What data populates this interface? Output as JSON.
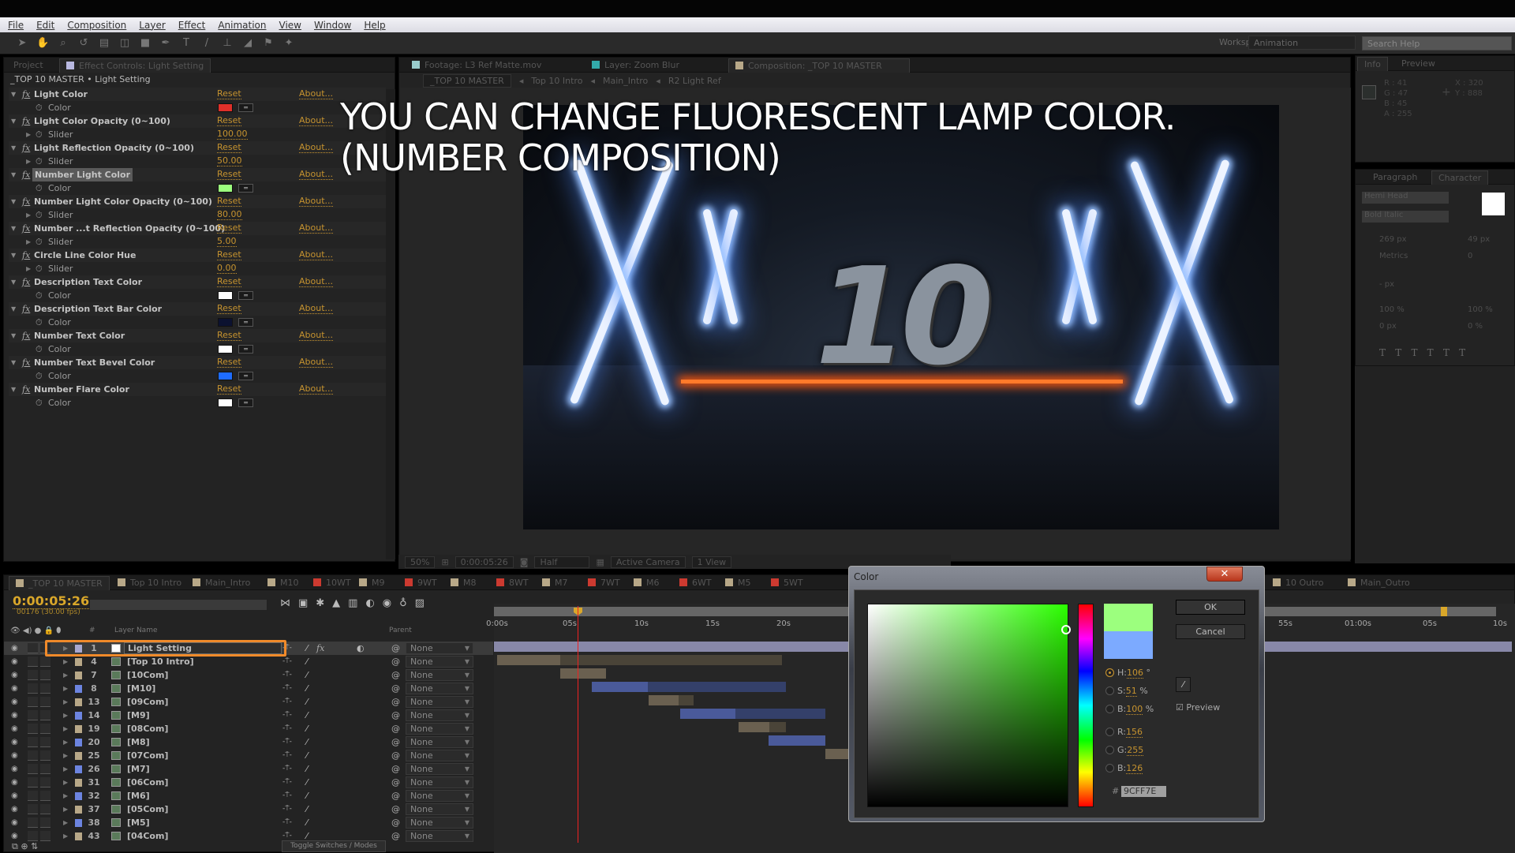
{
  "menu": [
    "File",
    "Edit",
    "Composition",
    "Layer",
    "Effect",
    "Animation",
    "View",
    "Window",
    "Help"
  ],
  "toolbar": {
    "workspace_label": "Workspace:",
    "workspace_value": "Animation",
    "search_placeholder": "Search Help"
  },
  "left_panel": {
    "tabs": [
      "Project",
      "Effect Controls: Light Setting"
    ],
    "breadcrumb": "_TOP 10 MASTER • Light Setting",
    "reset_label": "Reset",
    "about_label": "About...",
    "effects": [
      {
        "name": "Light Color",
        "param": "Color",
        "type": "color",
        "value": "#e0302a"
      },
      {
        "name": "Light Color Opacity (0~100)",
        "param": "Slider",
        "type": "slider",
        "value": "100.00"
      },
      {
        "name": "Light Reflection Opacity (0~100)",
        "param": "Slider",
        "type": "slider",
        "value": "50.00"
      },
      {
        "name": "Number Light Color",
        "param": "Color",
        "type": "color",
        "value": "#9cff7e",
        "selected": true
      },
      {
        "name": "Number Light Color Opacity (0~100)",
        "param": "Slider",
        "type": "slider",
        "value": "80.00"
      },
      {
        "name": "Number ...t Reflection Opacity (0~100)",
        "param": "Slider",
        "type": "slider",
        "value": "5.00"
      },
      {
        "name": "Circle Line Color Hue",
        "param": "Slider",
        "type": "slider",
        "value": "0.00"
      },
      {
        "name": "Description Text Color",
        "param": "Color",
        "type": "color",
        "value": "#ffffff"
      },
      {
        "name": "Description Text Bar Color",
        "param": "Color",
        "type": "color",
        "value": "#0c1230"
      },
      {
        "name": "Number Text Color",
        "param": "Color",
        "type": "color",
        "value": "#ffffff"
      },
      {
        "name": "Number Text Bevel Color",
        "param": "Color",
        "type": "color",
        "value": "#1e6cff"
      },
      {
        "name": "Number Flare Color",
        "param": "Color",
        "type": "color",
        "value": "#ffffff"
      }
    ]
  },
  "comp_panel": {
    "tabs": [
      "Footage: L3 Ref Matte.mov",
      "Layer: Zoom Blur",
      "Composition: _TOP 10 MASTER"
    ],
    "breadcrumb": [
      "_TOP 10 MASTER",
      "Top 10 Intro",
      "Main_Intro",
      "R2 Light Ref"
    ],
    "overlay_line1": "YOU CAN CHANGE FLUORESCENT LAMP COLOR.",
    "overlay_line2": "(NUMBER COMPOSITION)",
    "scene_number": "10",
    "viewer_toolbar": {
      "zoom": "50%",
      "timecode": "0:00:05:26",
      "resolution": "Half",
      "camera": "Active Camera",
      "views": "1 View"
    }
  },
  "info_panel": {
    "tabs": [
      "Info",
      "Preview"
    ],
    "r": "R : 41",
    "g": "G : 47",
    "b": "B : 45",
    "a": "A : 255",
    "x": "X : 320",
    "y": "Y : 888"
  },
  "character_panel": {
    "tabs": [
      "Paragraph",
      "Character"
    ],
    "font": "Hemi Head",
    "style": "Bold Italic",
    "size": "269 px",
    "leading": "49 px",
    "kerning": "Metrics",
    "tracking": "0",
    "stroke": "- px",
    "vscale": "100 %",
    "hscale": "100 %",
    "baseline": "0 px",
    "tsume": "0 %"
  },
  "timeline": {
    "tabs": [
      {
        "label": "_TOP 10 MASTER",
        "color": "#b8a888"
      },
      {
        "label": "Top 10 Intro",
        "color": "#b8a888"
      },
      {
        "label": "Main_Intro",
        "color": "#b8a888"
      },
      {
        "label": "M10",
        "color": "#b8a888"
      },
      {
        "label": "10WT",
        "color": "#cc3a30"
      },
      {
        "label": "M9",
        "color": "#b8a888"
      },
      {
        "label": "9WT",
        "color": "#cc3a30"
      },
      {
        "label": "M8",
        "color": "#b8a888"
      },
      {
        "label": "8WT",
        "color": "#cc3a30"
      },
      {
        "label": "M7",
        "color": "#b8a888"
      },
      {
        "label": "7WT",
        "color": "#cc3a30"
      },
      {
        "label": "M6",
        "color": "#b8a888"
      },
      {
        "label": "6WT",
        "color": "#cc3a30"
      },
      {
        "label": "M5",
        "color": "#b8a888"
      },
      {
        "label": "5WT",
        "color": "#cc3a30"
      },
      {
        "label": "10 Outro",
        "color": "#b8a888"
      },
      {
        "label": "Main_Outro",
        "color": "#b8a888"
      }
    ],
    "timecode": "0:00:05:26",
    "frames": "00176 (30.00 fps)",
    "col_num": "#",
    "col_layer_name": "Layer Name",
    "col_parent": "Parent",
    "parent_value": "None",
    "toggle_label": "Toggle Switches / Modes",
    "ruler": [
      "0:00s",
      "05s",
      "10s",
      "15s",
      "20s",
      "55s",
      "01:00s",
      "05s",
      "10s"
    ],
    "layers": [
      {
        "num": "1",
        "name": "Light Setting",
        "color": "#a8a8d0",
        "selected": true
      },
      {
        "num": "4",
        "name": "[Top 10 Intro]",
        "color": "#b8a888"
      },
      {
        "num": "7",
        "name": "[10Com]",
        "color": "#b8a888"
      },
      {
        "num": "8",
        "name": "[M10]",
        "color": "#6c84e0"
      },
      {
        "num": "13",
        "name": "[09Com]",
        "color": "#b8a888"
      },
      {
        "num": "14",
        "name": "[M9]",
        "color": "#6c84e0"
      },
      {
        "num": "19",
        "name": "[08Com]",
        "color": "#b8a888"
      },
      {
        "num": "20",
        "name": "[M8]",
        "color": "#6c84e0"
      },
      {
        "num": "25",
        "name": "[07Com]",
        "color": "#b8a888"
      },
      {
        "num": "26",
        "name": "[M7]",
        "color": "#6c84e0"
      },
      {
        "num": "31",
        "name": "[06Com]",
        "color": "#b8a888"
      },
      {
        "num": "32",
        "name": "[M6]",
        "color": "#6c84e0"
      },
      {
        "num": "37",
        "name": "[05Com]",
        "color": "#b8a888"
      },
      {
        "num": "38",
        "name": "[M5]",
        "color": "#6c84e0"
      },
      {
        "num": "43",
        "name": "[04Com]",
        "color": "#b8a888"
      }
    ]
  },
  "color_dialog": {
    "title": "Color",
    "ok": "OK",
    "cancel": "Cancel",
    "preview": "Preview",
    "h_label": "H:",
    "h": "106",
    "h_unit": "°",
    "s_label": "S:",
    "s": "51",
    "s_unit": "%",
    "b_label": "B:",
    "b": "100",
    "b_unit": "%",
    "r_label": "R:",
    "r": "156",
    "g_label": "G:",
    "g": "255",
    "bl_label": "B:",
    "bl": "126",
    "hex_label": "#",
    "hex": "9CFF7E",
    "new_color": "#9cff7e",
    "old_color": "#7caaff",
    "hue_color": "#2bff00"
  }
}
